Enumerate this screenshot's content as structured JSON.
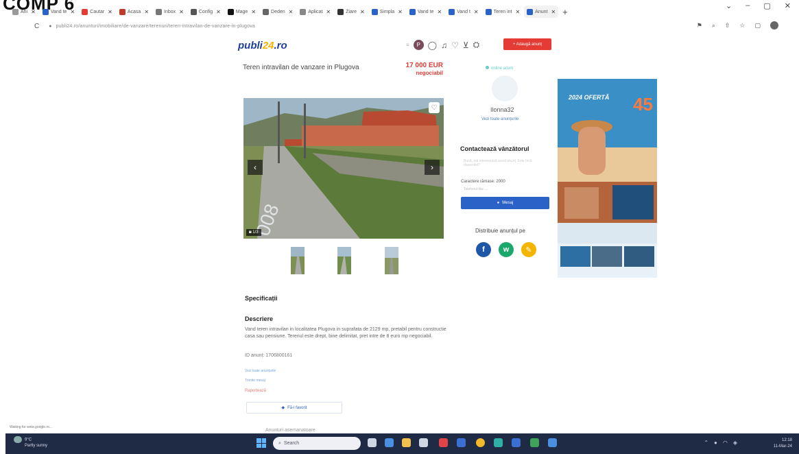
{
  "stamp": "COMP 6",
  "browser": {
    "tabs": [
      {
        "label": "Ahi",
        "color": "#9a9a9a"
      },
      {
        "label": "Vand te",
        "color": "#2a62c8"
      },
      {
        "label": "Cautar",
        "color": "#e53b35"
      },
      {
        "label": "Acasa",
        "color": "#c0392b"
      },
      {
        "label": "Inbox",
        "color": "#777777"
      },
      {
        "label": "Config",
        "color": "#555555"
      },
      {
        "label": "Mage",
        "color": "#111111"
      },
      {
        "label": "Deden",
        "color": "#666666"
      },
      {
        "label": "Aplicat",
        "color": "#888888"
      },
      {
        "label": "Ziare",
        "color": "#333333"
      },
      {
        "label": "Simpla",
        "color": "#2a62c8"
      },
      {
        "label": "Vand te",
        "color": "#2a62c8"
      },
      {
        "label": "Vand t",
        "color": "#2a62c8"
      },
      {
        "label": "Teren int",
        "color": "#2a62c8"
      },
      {
        "label": "Anunt",
        "color": "#2a62c8"
      }
    ],
    "new_tab": "+",
    "window_controls": [
      "⌄",
      "–",
      "▢",
      "✕"
    ],
    "reload": "C",
    "url": "publi24.ro/anunturi/imobiliare/de-vanzare/terenuri/teren-intravilan-de-vanzare-in-plugova"
  },
  "site": {
    "logo_prefix": "publi",
    "logo_mid": "24",
    "logo_suffix": ".ro",
    "avatar_letter": "P",
    "add_button": "+ Adaugă anunț"
  },
  "listing": {
    "title": "Teren intravilan de vanzare in Plugova",
    "price": "17 000 EUR",
    "negotiable": "negociabil",
    "photo_count": "1/3",
    "specs_title": "Specificații",
    "desc_title": "Descriere",
    "description": "Vand teren intravilan in localitatea Plugova in suprafata de 2129 mp, pretabil pentru constructie casa sau pensiune. Terenul este drept, bine delimitat, pret intre de 8 euro mp negociabil.",
    "id_line": "ID anunț: 1706800161",
    "link1": "Vezi toate anunțurile",
    "link2": "Trimite mesaj",
    "report": "Raportează",
    "fav_button": "Fă-l favorit",
    "cut_text": "Anunturi asemanatoare"
  },
  "seller": {
    "online": "online acum",
    "name": "Ilonna32",
    "more": "Vezi toate anunțurile",
    "contact_title": "Contactează vânzătorul",
    "msg_hint": "Bună, mă interesează acest anunț. Este încă disponibil?",
    "char_limit": "Caractere rămase: 2000",
    "char_sub": "Telefonul tău: ...",
    "send": "Mesaj",
    "share_title": "Distribuie anunțul pe",
    "share": [
      {
        "label": "f",
        "color": "#1f57a8"
      },
      {
        "label": "w",
        "color": "#1aa86b"
      },
      {
        "label": "✎",
        "color": "#f3b500"
      }
    ]
  },
  "ad": {
    "headline": "2024 OFERTĂ",
    "big_number": "45"
  },
  "taskbar": {
    "weather_temp": "9°C",
    "weather_desc": "Partly sunny",
    "search": "Search",
    "time": "12:18",
    "date": "11-Mar-24",
    "status_url": "Waiting for www.google.ro..."
  }
}
